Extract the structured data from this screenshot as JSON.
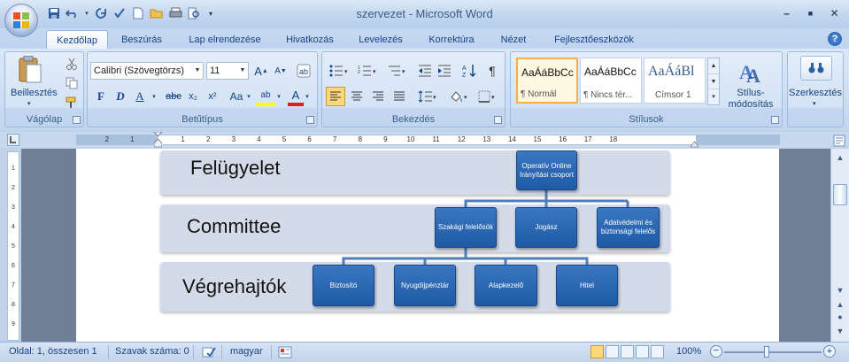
{
  "window": {
    "doc_name": "szervezet",
    "separator": " - ",
    "app_name": "Microsoft Word",
    "minimize": "–",
    "maximize": "■",
    "close": "✕"
  },
  "tabs": [
    "Kezdőlap",
    "Beszúrás",
    "Lap elrendezése",
    "Hivatkozás",
    "Levelezés",
    "Korrektúra",
    "Nézet",
    "Fejlesztőeszközök"
  ],
  "active_tab": "Kezdőlap",
  "ribbon": {
    "clipboard": {
      "label": "Vágólap",
      "paste": "Beillesztés"
    },
    "font": {
      "label": "Betűtípus",
      "font_name": "Calibri (Szövegtörzs)",
      "font_size": "11",
      "bold": "F",
      "italic": "D",
      "underline": "A",
      "strike": "abc",
      "subscript": "x₂",
      "superscript": "x²",
      "change_case": "Aa",
      "grow": "A",
      "shrink": "A",
      "highlight": "ab",
      "font_color": "A"
    },
    "paragraph": {
      "label": "Bekezdés"
    },
    "styles": {
      "label": "Stílusok",
      "items": [
        {
          "preview": "AaÁáBbCc",
          "name": "¶ Normál"
        },
        {
          "preview": "AaÁáBbCc",
          "name": "¶ Nincs tér..."
        },
        {
          "preview": "AaÁáBl",
          "name": "Címsor 1"
        }
      ],
      "change_styles": "Stílus-\nmódosítás"
    },
    "editing": {
      "label": "Szerkesztés"
    }
  },
  "ruler": {
    "left_numbers": [
      "2",
      "1"
    ],
    "numbers": [
      "1",
      "2",
      "3",
      "4",
      "5",
      "6",
      "7",
      "8",
      "9",
      "10",
      "11",
      "12",
      "13",
      "14",
      "15",
      "16",
      "17",
      "18"
    ]
  },
  "diagram": {
    "bands": [
      "Felügyelet",
      "Committee",
      "Végrehajtók"
    ],
    "top_node": "Operatív Online Irányítási csoport",
    "mid_nodes": [
      "Szakági felelősök",
      "Jogász",
      "Adatvédelmi és biztonsági felelős"
    ],
    "bottom_nodes": [
      "Biztosító",
      "Nyugdíjpénztár",
      "Alapkezelő",
      "Hitel"
    ],
    "node_color": "#2a66b3"
  },
  "status": {
    "page": "Oldal: 1, összesen 1",
    "words": "Szavak száma: 0",
    "language": "magyar",
    "zoom": "100%"
  }
}
